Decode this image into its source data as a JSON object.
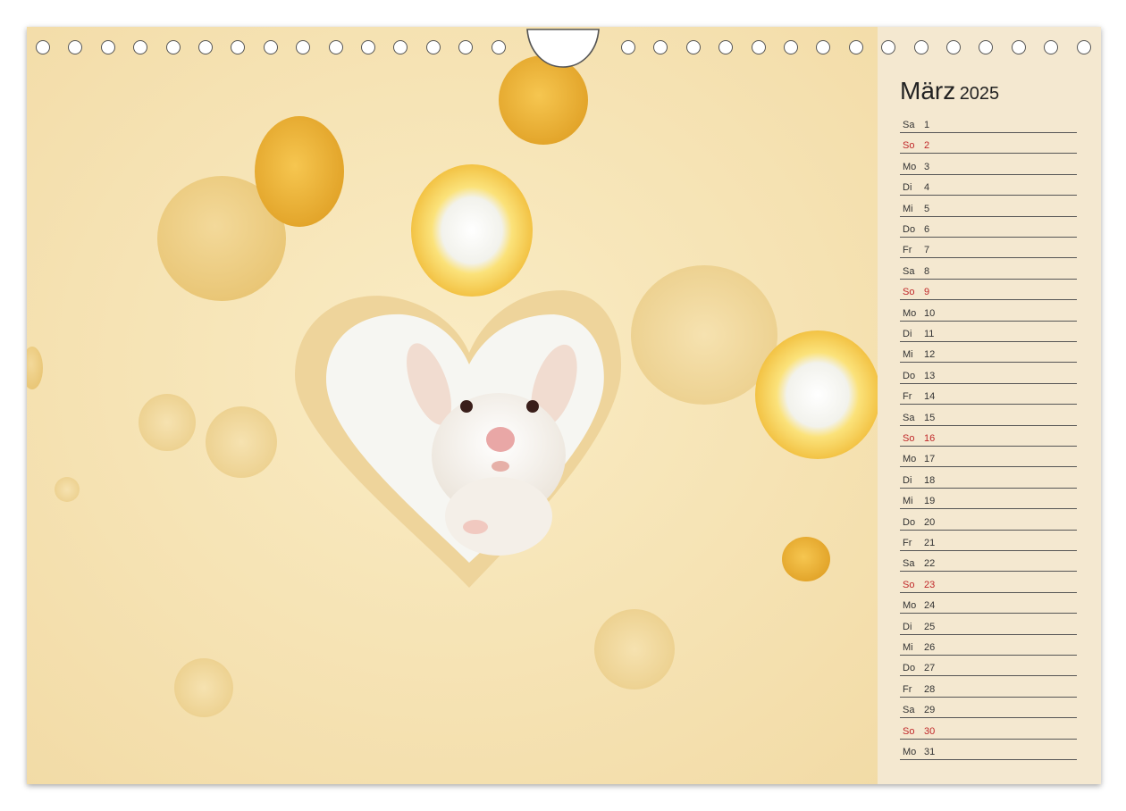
{
  "calendar": {
    "month": "März",
    "year": "2025",
    "days": [
      {
        "wd": "Sa",
        "d": "1",
        "sun": false
      },
      {
        "wd": "So",
        "d": "2",
        "sun": true
      },
      {
        "wd": "Mo",
        "d": "3",
        "sun": false
      },
      {
        "wd": "Di",
        "d": "4",
        "sun": false
      },
      {
        "wd": "Mi",
        "d": "5",
        "sun": false
      },
      {
        "wd": "Do",
        "d": "6",
        "sun": false
      },
      {
        "wd": "Fr",
        "d": "7",
        "sun": false
      },
      {
        "wd": "Sa",
        "d": "8",
        "sun": false
      },
      {
        "wd": "So",
        "d": "9",
        "sun": true
      },
      {
        "wd": "Mo",
        "d": "10",
        "sun": false
      },
      {
        "wd": "Di",
        "d": "11",
        "sun": false
      },
      {
        "wd": "Mi",
        "d": "12",
        "sun": false
      },
      {
        "wd": "Do",
        "d": "13",
        "sun": false
      },
      {
        "wd": "Fr",
        "d": "14",
        "sun": false
      },
      {
        "wd": "Sa",
        "d": "15",
        "sun": false
      },
      {
        "wd": "So",
        "d": "16",
        "sun": true
      },
      {
        "wd": "Mo",
        "d": "17",
        "sun": false
      },
      {
        "wd": "Di",
        "d": "18",
        "sun": false
      },
      {
        "wd": "Mi",
        "d": "19",
        "sun": false
      },
      {
        "wd": "Do",
        "d": "20",
        "sun": false
      },
      {
        "wd": "Fr",
        "d": "21",
        "sun": false
      },
      {
        "wd": "Sa",
        "d": "22",
        "sun": false
      },
      {
        "wd": "So",
        "d": "23",
        "sun": true
      },
      {
        "wd": "Mo",
        "d": "24",
        "sun": false
      },
      {
        "wd": "Di",
        "d": "25",
        "sun": false
      },
      {
        "wd": "Mi",
        "d": "26",
        "sun": false
      },
      {
        "wd": "Do",
        "d": "27",
        "sun": false
      },
      {
        "wd": "Fr",
        "d": "28",
        "sun": false
      },
      {
        "wd": "Sa",
        "d": "29",
        "sun": false
      },
      {
        "wd": "So",
        "d": "30",
        "sun": true
      },
      {
        "wd": "Mo",
        "d": "31",
        "sun": false
      }
    ]
  },
  "colors": {
    "cheese_base": "#f7e6b8",
    "sunday_red": "#c0282a",
    "sidebar_bg": "#f4e8d0"
  }
}
